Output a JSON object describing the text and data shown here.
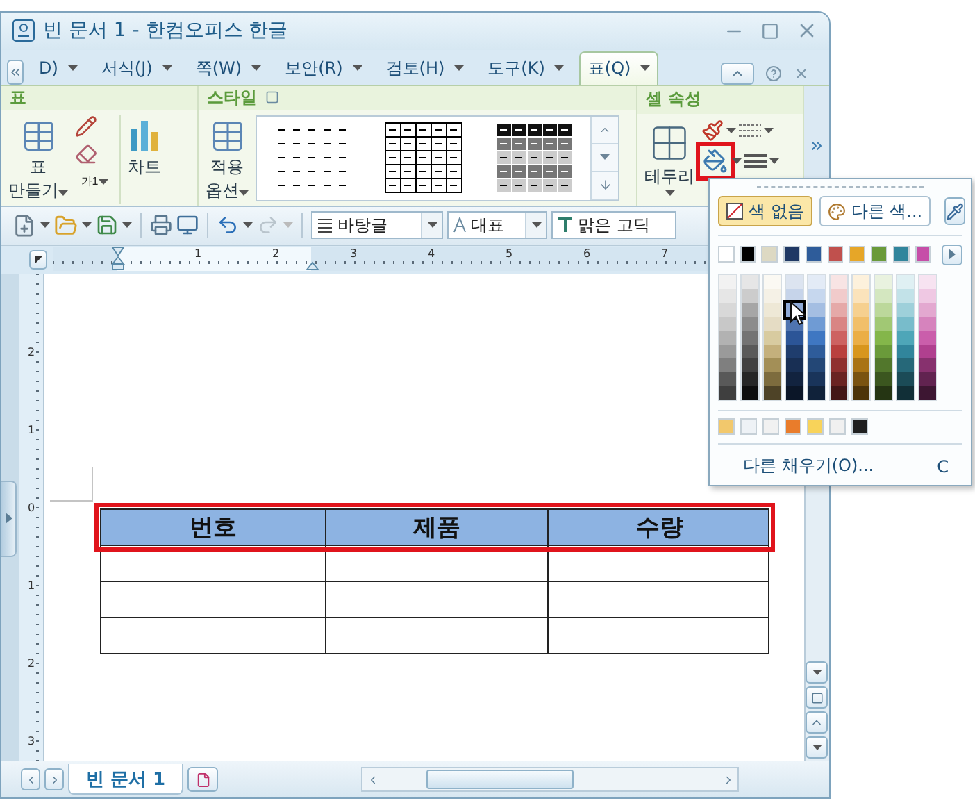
{
  "window": {
    "title": "빈 문서 1 - 한컴오피스 한글"
  },
  "menu_tabs": [
    {
      "label": "D)",
      "selected": false
    },
    {
      "label": "서식(J)",
      "selected": false
    },
    {
      "label": "쪽(W)",
      "selected": false
    },
    {
      "label": "보안(R)",
      "selected": false
    },
    {
      "label": "검토(H)",
      "selected": false
    },
    {
      "label": "도구(K)",
      "selected": false
    },
    {
      "label": "표(Q)",
      "selected": true
    }
  ],
  "ribbon": {
    "table_group": {
      "title": "표",
      "create_lines": [
        "표",
        "만들기"
      ],
      "cell_label": "가1",
      "chart_label": "차트"
    },
    "style_group": {
      "title": "스타일",
      "apply_lines": [
        "적용",
        "옵션"
      ]
    },
    "cell_group": {
      "title": "셀 속성",
      "border_label": "테두리",
      "fill_highlighted": true
    }
  },
  "toolbar": {
    "redo_disabled": true,
    "style_combo": "바탕글",
    "para_combo": "대표",
    "font_combo": "맑은 고딕"
  },
  "ruler": {
    "h_labels": [
      "1",
      "2",
      "3",
      "4",
      "5",
      "6",
      "7"
    ],
    "v_labels": [
      "2",
      "1",
      "0",
      "1",
      "2",
      "3"
    ]
  },
  "table": {
    "header_highlighted": true,
    "columns": [
      "번호",
      "제품",
      "수량"
    ],
    "rows": [
      {
        "kind": "empty"
      },
      {
        "kind": "empty"
      },
      {
        "kind": "empty"
      }
    ]
  },
  "doc_tabs": [
    {
      "label": "빈 문서 1",
      "selected": true
    }
  ],
  "color_popup": {
    "buttons": [
      {
        "label": "색 없음",
        "kind": "none",
        "selected": true
      },
      {
        "label": "다른 색...",
        "kind": "palette",
        "selected": false
      }
    ],
    "theme_colors": [
      {
        "color": "#ffffff"
      },
      {
        "color": "#000000"
      },
      {
        "color": "#ddd9c3"
      },
      {
        "color": "#1f3864"
      },
      {
        "color": "#2e5c9a"
      },
      {
        "color": "#c0504d"
      },
      {
        "color": "#e6a628"
      },
      {
        "color": "#6a9a3a"
      },
      {
        "color": "#31859c"
      },
      {
        "color": "#c64ea8"
      }
    ],
    "shades": [
      [
        {
          "color": "#f2f2f2",
          "selected": false
        },
        {
          "color": "#e6e6e6",
          "selected": false
        },
        {
          "color": "#d8d8d8",
          "selected": false
        },
        {
          "color": "#c8c8c8",
          "selected": false
        },
        {
          "color": "#b2b2b2",
          "selected": false
        },
        {
          "color": "#9a9a9a",
          "selected": false
        },
        {
          "color": "#7f7f7f",
          "selected": false
        },
        {
          "color": "#595959",
          "selected": false
        },
        {
          "color": "#3f3f3f",
          "selected": false
        }
      ],
      [
        {
          "color": "#e6e6e6",
          "selected": false
        },
        {
          "color": "#cccccc",
          "selected": false
        },
        {
          "color": "#a6a6a6",
          "selected": false
        },
        {
          "color": "#8c8c8c",
          "selected": false
        },
        {
          "color": "#737373",
          "selected": false
        },
        {
          "color": "#595959",
          "selected": false
        },
        {
          "color": "#404040",
          "selected": false
        },
        {
          "color": "#262626",
          "selected": false
        },
        {
          "color": "#0d0d0d",
          "selected": false
        }
      ],
      [
        {
          "color": "#fbf9f3",
          "selected": false
        },
        {
          "color": "#f5f1e6",
          "selected": false
        },
        {
          "color": "#eee8d6",
          "selected": false
        },
        {
          "color": "#e5dcc4",
          "selected": false
        },
        {
          "color": "#d8cba0",
          "selected": false
        },
        {
          "color": "#c4b07c",
          "selected": false
        },
        {
          "color": "#a38f57",
          "selected": false
        },
        {
          "color": "#7d6c3e",
          "selected": false
        },
        {
          "color": "#4e4327",
          "selected": false
        }
      ],
      [
        {
          "color": "#dce4f0",
          "selected": false
        },
        {
          "color": "#c6d4ea",
          "selected": false
        },
        {
          "color": "#8faad7",
          "selected": true
        },
        {
          "color": "#4f74b0",
          "selected": false
        },
        {
          "color": "#2c5597",
          "selected": false
        },
        {
          "color": "#1f3d6d",
          "selected": false
        },
        {
          "color": "#182f54",
          "selected": false
        },
        {
          "color": "#12233f",
          "selected": false
        },
        {
          "color": "#0b1628",
          "selected": false
        }
      ],
      [
        {
          "color": "#e3ebf6",
          "selected": false
        },
        {
          "color": "#c6d7ee",
          "selected": false
        },
        {
          "color": "#a4bee2",
          "selected": false
        },
        {
          "color": "#6f9bd4",
          "selected": false
        },
        {
          "color": "#3f77c2",
          "selected": false
        },
        {
          "color": "#2e5c9a",
          "selected": false
        },
        {
          "color": "#234776",
          "selected": false
        },
        {
          "color": "#19345a",
          "selected": false
        },
        {
          "color": "#10223a",
          "selected": false
        }
      ],
      [
        {
          "color": "#f8e4e4",
          "selected": false
        },
        {
          "color": "#f1cbcb",
          "selected": false
        },
        {
          "color": "#e5a9a8",
          "selected": false
        },
        {
          "color": "#d98584",
          "selected": false
        },
        {
          "color": "#cd6261",
          "selected": false
        },
        {
          "color": "#b9403e",
          "selected": false
        },
        {
          "color": "#8f302f",
          "selected": false
        },
        {
          "color": "#6a2322",
          "selected": false
        },
        {
          "color": "#431616",
          "selected": false
        }
      ],
      [
        {
          "color": "#fdf1dc",
          "selected": false
        },
        {
          "color": "#fbe3bb",
          "selected": false
        },
        {
          "color": "#f6d08f",
          "selected": false
        },
        {
          "color": "#f1bf6a",
          "selected": false
        },
        {
          "color": "#ebae45",
          "selected": false
        },
        {
          "color": "#d8961d",
          "selected": false
        },
        {
          "color": "#a97315",
          "selected": false
        },
        {
          "color": "#7a5310",
          "selected": false
        },
        {
          "color": "#4d3409",
          "selected": false
        }
      ],
      [
        {
          "color": "#e9f2df",
          "selected": false
        },
        {
          "color": "#d4e7c0",
          "selected": false
        },
        {
          "color": "#bcd89b",
          "selected": false
        },
        {
          "color": "#a1c874",
          "selected": false
        },
        {
          "color": "#84b64a",
          "selected": false
        },
        {
          "color": "#6a9a3a",
          "selected": false
        },
        {
          "color": "#52772c",
          "selected": false
        },
        {
          "color": "#3b561f",
          "selected": false
        },
        {
          "color": "#253513",
          "selected": false
        }
      ],
      [
        {
          "color": "#dff0f3",
          "selected": false
        },
        {
          "color": "#c2e2e8",
          "selected": false
        },
        {
          "color": "#9ed0da",
          "selected": false
        },
        {
          "color": "#78bccb",
          "selected": false
        },
        {
          "color": "#4ea6b8",
          "selected": false
        },
        {
          "color": "#31859c",
          "selected": false
        },
        {
          "color": "#266879",
          "selected": false
        },
        {
          "color": "#1b4b57",
          "selected": false
        },
        {
          "color": "#112f37",
          "selected": false
        }
      ],
      [
        {
          "color": "#f7e3f1",
          "selected": false
        },
        {
          "color": "#efc8e3",
          "selected": false
        },
        {
          "color": "#e3a8d0",
          "selected": false
        },
        {
          "color": "#d683bd",
          "selected": false
        },
        {
          "color": "#ca5eab",
          "selected": false
        },
        {
          "color": "#b0408f",
          "selected": false
        },
        {
          "color": "#87316e",
          "selected": false
        },
        {
          "color": "#612350",
          "selected": false
        },
        {
          "color": "#3d1632",
          "selected": false
        }
      ]
    ],
    "recent_colors": [
      {
        "color": "#f2c86c"
      },
      {
        "color": "#eef2f6"
      },
      {
        "color": "#f1f1f1"
      },
      {
        "color": "#e97c2b"
      },
      {
        "color": "#f8d35a"
      },
      {
        "color": "#f0f0f0"
      },
      {
        "color": "#1f1f1f"
      }
    ],
    "more_fill": "다른 채우기(O)...",
    "shortcut": "C"
  }
}
